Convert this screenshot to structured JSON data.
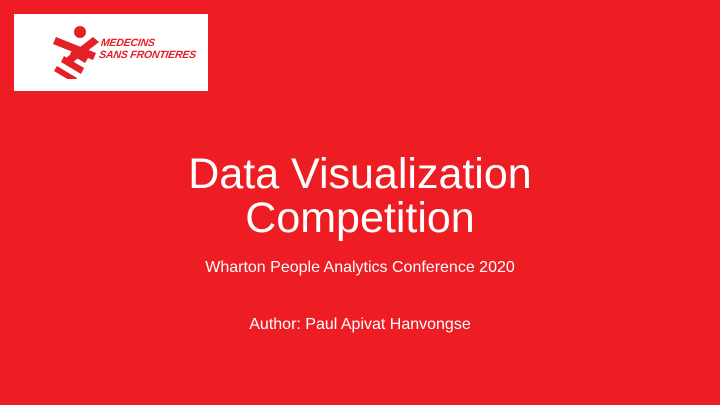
{
  "slide": {
    "background_color": "#ee1d23",
    "logo": {
      "icon": "msf-running-man-icon",
      "line1": "MEDECINS",
      "line2": "SANS FRONTIERES",
      "color": "#e41f26",
      "box_color": "#ffffff"
    },
    "title_line1": "Data Visualization",
    "title_line2": "Competition",
    "subtitle": "Wharton People Analytics Conference 2020",
    "author": "Author: Paul Apivat Hanvongse"
  }
}
